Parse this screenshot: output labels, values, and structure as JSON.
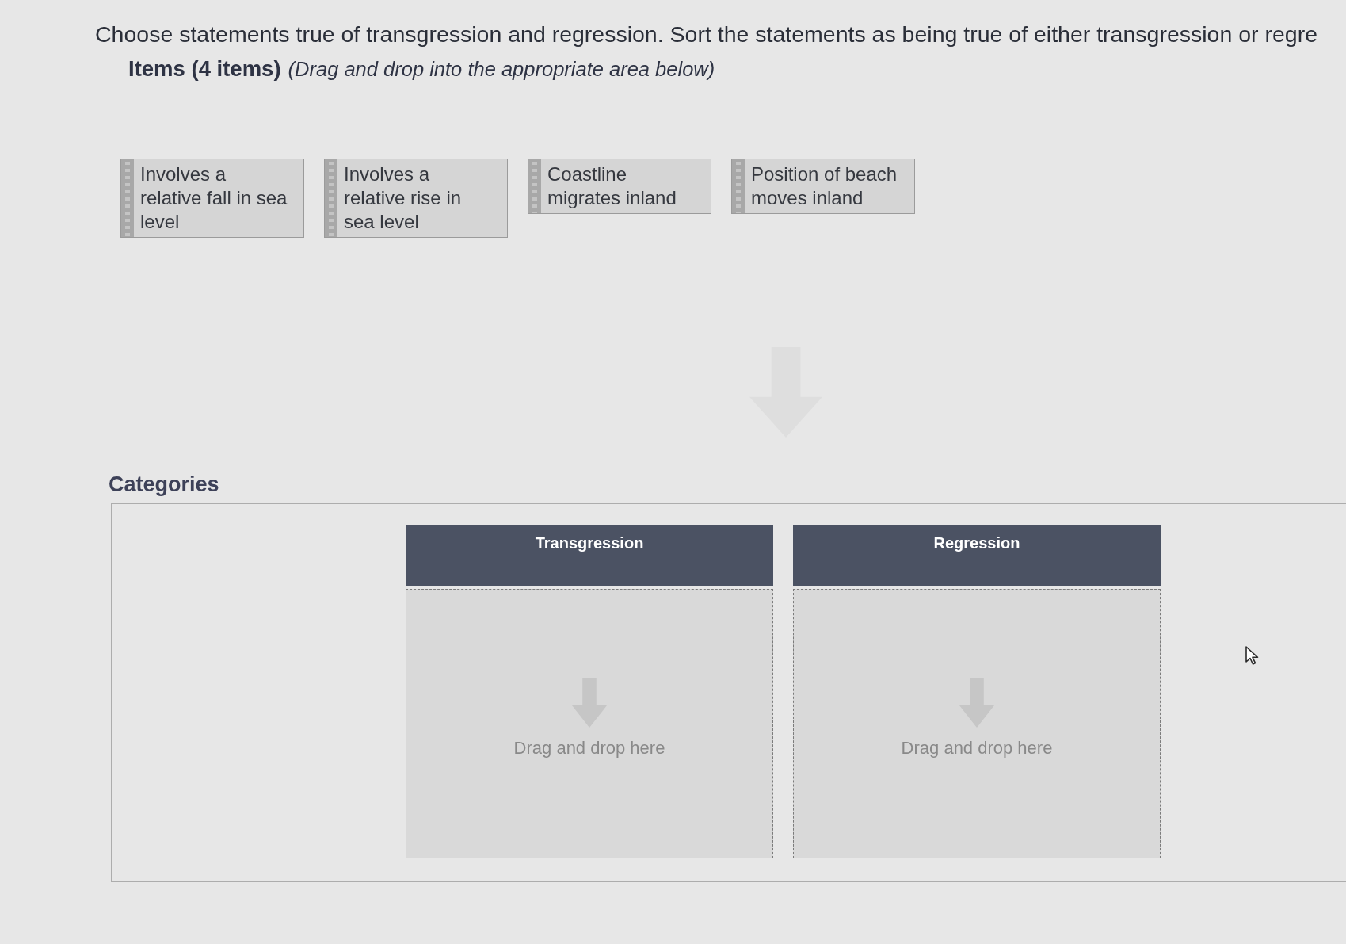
{
  "question": {
    "text": "Choose statements true of transgression and regression. Sort the statements as being true of either transgression or regre"
  },
  "items_section": {
    "title": "Items (4 items)",
    "hint": "(Drag and drop into the appropriate area below)"
  },
  "items": [
    {
      "label": "Involves a relative fall in sea level"
    },
    {
      "label": "Involves a relative rise in sea level"
    },
    {
      "label": "Coastline migrates inland"
    },
    {
      "label": "Position of beach moves inland"
    }
  ],
  "categories_section": {
    "title": "Categories"
  },
  "categories": [
    {
      "title": "Transgression",
      "drop_hint": "Drag and drop here"
    },
    {
      "title": "Regression",
      "drop_hint": "Drag and drop here"
    }
  ]
}
